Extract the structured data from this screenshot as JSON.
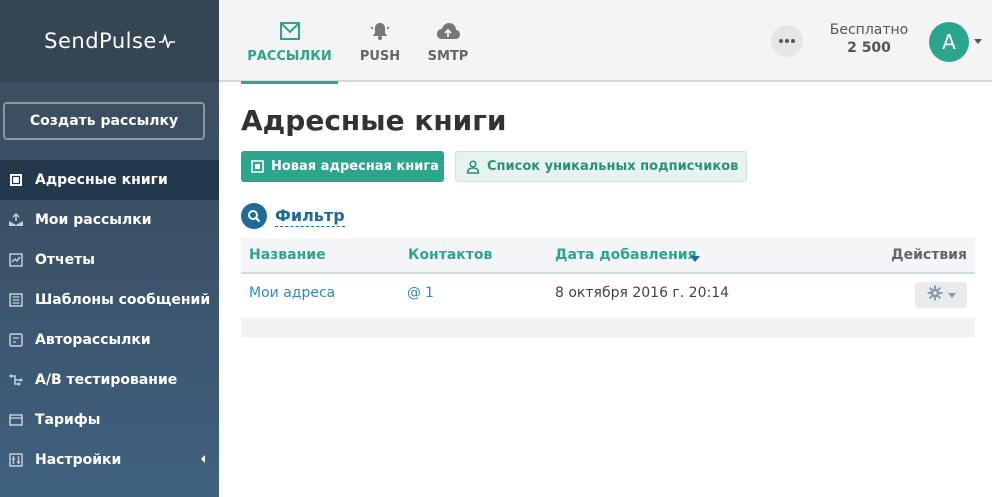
{
  "sidebar": {
    "logo": "SendPulse",
    "create_button": "Создать рассылку",
    "items": [
      {
        "label": "Адресные книги",
        "icon": "address-book-icon",
        "active": true
      },
      {
        "label": "Мои рассылки",
        "icon": "send-icon"
      },
      {
        "label": "Отчеты",
        "icon": "chart-icon"
      },
      {
        "label": "Шаблоны сообщений",
        "icon": "template-icon"
      },
      {
        "label": "Авторассылки",
        "icon": "automation-icon"
      },
      {
        "label": "A/B тестирование",
        "icon": "ab-test-icon"
      },
      {
        "label": "Тарифы",
        "icon": "wallet-icon"
      },
      {
        "label": "Настройки",
        "icon": "sliders-icon"
      }
    ]
  },
  "topbar": {
    "tabs": [
      {
        "label": "РАССЫЛКИ",
        "icon": "email-icon",
        "active": true
      },
      {
        "label": "PUSH",
        "icon": "bell-icon"
      },
      {
        "label": "SMTP",
        "icon": "cloud-upload-icon"
      }
    ],
    "plan_name": "Бесплатно",
    "plan_credits": "2 500",
    "avatar_letter": "A"
  },
  "main": {
    "title": "Адресные книги",
    "new_book_button": "Новая адресная книга",
    "unique_subscribers_button": "Список уникальных подписчиков",
    "filter_label": "Фильтр",
    "table": {
      "headers": {
        "name": "Название",
        "contacts": "Контактов",
        "date": "Дата добавления",
        "actions": "Действия"
      },
      "rows": [
        {
          "name": "Мои адреса",
          "contacts": "1",
          "date": "8 октября 2016 г. 20:14"
        }
      ]
    }
  },
  "colors": {
    "accent": "#2ca58d",
    "link": "#2c8fb0",
    "filter": "#1f6b96",
    "sidebar": "#3b5166"
  }
}
